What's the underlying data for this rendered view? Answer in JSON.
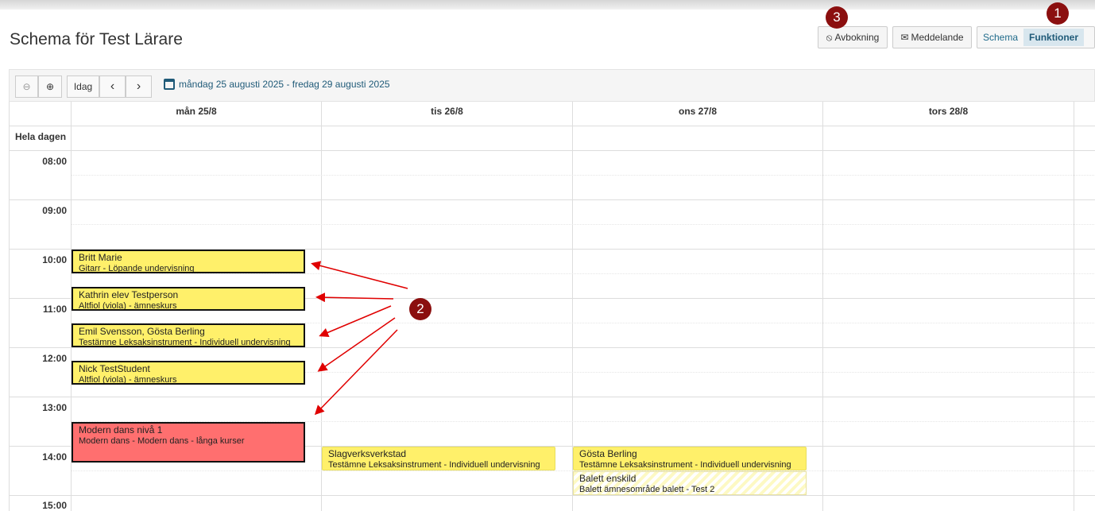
{
  "page_title": "Schema för Test Lärare",
  "header_buttons": {
    "avbokning": "Avbokning",
    "meddelande": "Meddelande",
    "schema": "Schema",
    "funktioner": "Funktioner"
  },
  "badges": {
    "one": "1",
    "two": "2",
    "three": "3"
  },
  "toolbar": {
    "zoom_out": "⊖",
    "zoom_in": "⊕",
    "today": "Idag",
    "prev": "‹",
    "next": "›",
    "date_range": "måndag 25 augusti 2025 - fredag 29 augusti 2025"
  },
  "calendar": {
    "days": [
      "mån 25/8",
      "tis 26/8",
      "ons 27/8",
      "tors 28/8"
    ],
    "allday_label": "Hela dagen",
    "times": [
      "08:00",
      "09:00",
      "10:00",
      "11:00",
      "12:00",
      "13:00",
      "14:00",
      "15:00"
    ],
    "events": [
      {
        "title": "Britt Marie",
        "subtitle": "Gitarr - Löpande undervisning"
      },
      {
        "title": "Kathrin elev Testperson",
        "subtitle": "Altfiol (viola) - ämneskurs"
      },
      {
        "title": "Emil Svensson, Gösta Berling",
        "subtitle": "Testämne Leksaksinstrument - Individuell undervisning"
      },
      {
        "title": "Nick TestStudent",
        "subtitle": "Altfiol (viola) - ämneskurs"
      },
      {
        "title": "Modern dans nivå 1",
        "subtitle": "Modern dans - Modern dans - långa kurser"
      },
      {
        "title": "Slagverksverkstad",
        "subtitle": "Testämne Leksaksinstrument - Individuell undervisning"
      },
      {
        "title": "Gösta Berling",
        "subtitle": "Testämne Leksaksinstrument - Individuell undervisning"
      },
      {
        "title": "Balett enskild",
        "subtitle": "Balett ämnesområde balett - Test 2"
      }
    ]
  },
  "colors": {
    "event_yellow": "#fff06a",
    "event_red": "#ff6f6f",
    "badge": "#8b0f0f",
    "arrow": "#e00000"
  }
}
